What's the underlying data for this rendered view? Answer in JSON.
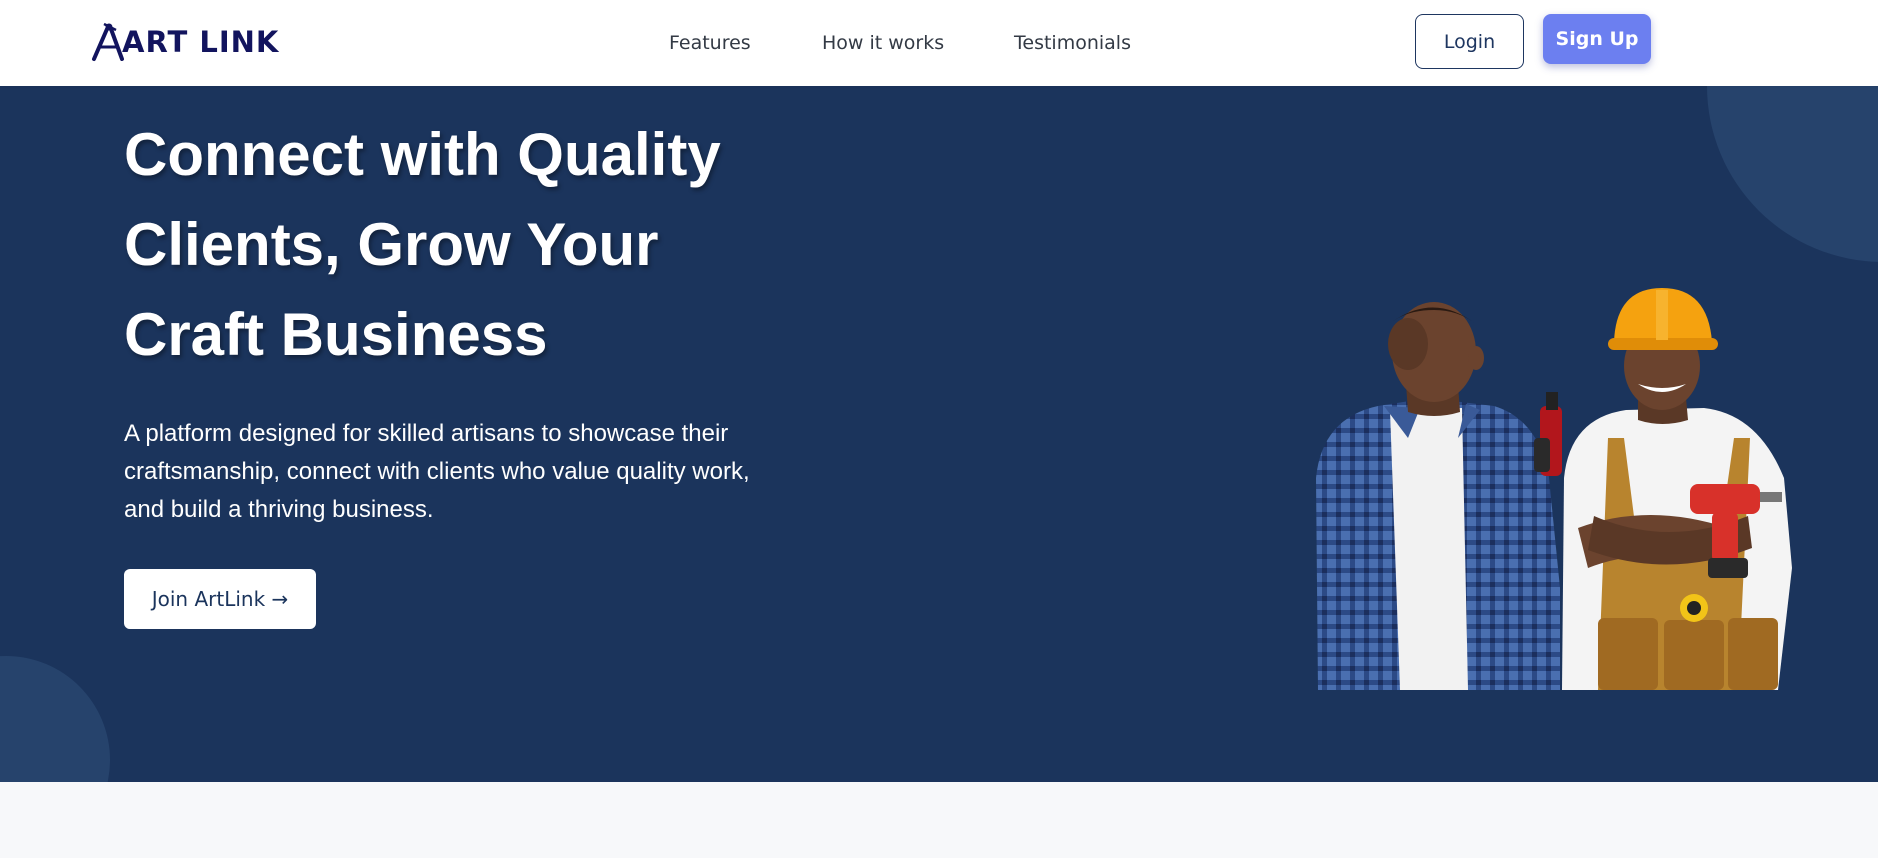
{
  "brand": {
    "name": "ART LINK"
  },
  "nav": {
    "links": [
      "Features",
      "How it works",
      "Testimonials"
    ],
    "login_label": "Login",
    "signup_label": "Sign Up"
  },
  "hero": {
    "title": "Connect with Quality Clients, Grow Your Craft Business",
    "description": "A platform designed for skilled artisans to showcase their craftsmanship, connect with clients who value quality work, and build a thriving business.",
    "cta_label": "Join ArtLink →",
    "image_subject": "two-craftsmen-with-power-drills"
  },
  "colors": {
    "hero_bg": "#1b345c",
    "brand_text": "#12145e",
    "signup_bg": "#6c7ff0",
    "page_bg": "#f7f8fa"
  }
}
